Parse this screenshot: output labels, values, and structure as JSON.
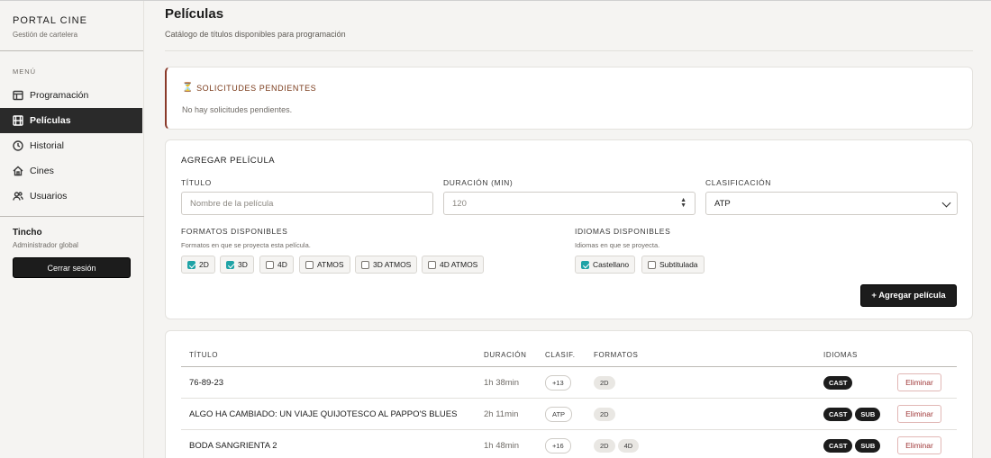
{
  "sidebar": {
    "brand_title": "PORTAL CINE",
    "brand_sub": "Gestión de cartelera",
    "menu_label": "MENÚ",
    "items": [
      {
        "label": "Programación",
        "icon": "calendar-icon"
      },
      {
        "label": "Películas",
        "icon": "film-icon",
        "active": true
      },
      {
        "label": "Historial",
        "icon": "clock-icon"
      },
      {
        "label": "Cines",
        "icon": "home-icon"
      },
      {
        "label": "Usuarios",
        "icon": "users-icon"
      }
    ],
    "user_name": "Tincho",
    "user_role": "Administrador global",
    "logout_label": "Cerrar sesión"
  },
  "header": {
    "title": "Películas",
    "subtitle": "Catálogo de títulos disponibles para programación"
  },
  "pending": {
    "title": "SOLICITUDES PENDIENTES",
    "icon": "hourglass-icon",
    "empty_text": "No hay solicitudes pendientes."
  },
  "add_form": {
    "title": "AGREGAR PELÍCULA",
    "title_label": "TÍTULO",
    "title_placeholder": "Nombre de la película",
    "duration_label": "DURACIÓN (MIN)",
    "duration_placeholder": "120",
    "rating_label": "CLASIFICACIÓN",
    "rating_value": "ATP",
    "formats_label": "FORMATOS DISPONIBLES",
    "formats_hint": "Formatos en que se proyecta esta película.",
    "formats": [
      {
        "label": "2D",
        "checked": true
      },
      {
        "label": "3D",
        "checked": true
      },
      {
        "label": "4D",
        "checked": false
      },
      {
        "label": "ATMOS",
        "checked": false
      },
      {
        "label": "3D ATMOS",
        "checked": false
      },
      {
        "label": "4D ATMOS",
        "checked": false
      }
    ],
    "languages_label": "IDIOMAS DISPONIBLES",
    "languages_hint": "Idiomas en que se proyecta.",
    "languages": [
      {
        "label": "Castellano",
        "checked": true
      },
      {
        "label": "Subtitulada",
        "checked": false
      }
    ],
    "submit_label": "+ Agregar película"
  },
  "table": {
    "headers": {
      "title": "TÍTULO",
      "duration": "DURACIÓN",
      "rating": "CLASIF.",
      "formats": "FORMATOS",
      "languages": "IDIOMAS"
    },
    "delete_label": "Eliminar",
    "rows": [
      {
        "title": "76-89-23",
        "duration": "1h 38min",
        "rating": "+13",
        "formats": [
          "2D"
        ],
        "languages": [
          "CAST"
        ]
      },
      {
        "title": "ALGO HA CAMBIADO: UN VIAJE QUIJOTESCO AL PAPPO'S BLUES",
        "duration": "2h 11min",
        "rating": "ATP",
        "formats": [
          "2D"
        ],
        "languages": [
          "CAST",
          "SUB"
        ]
      },
      {
        "title": "BODA SANGRIENTA 2",
        "duration": "1h 48min",
        "rating": "+16",
        "formats": [
          "2D",
          "4D"
        ],
        "languages": [
          "CAST",
          "SUB"
        ]
      }
    ]
  }
}
